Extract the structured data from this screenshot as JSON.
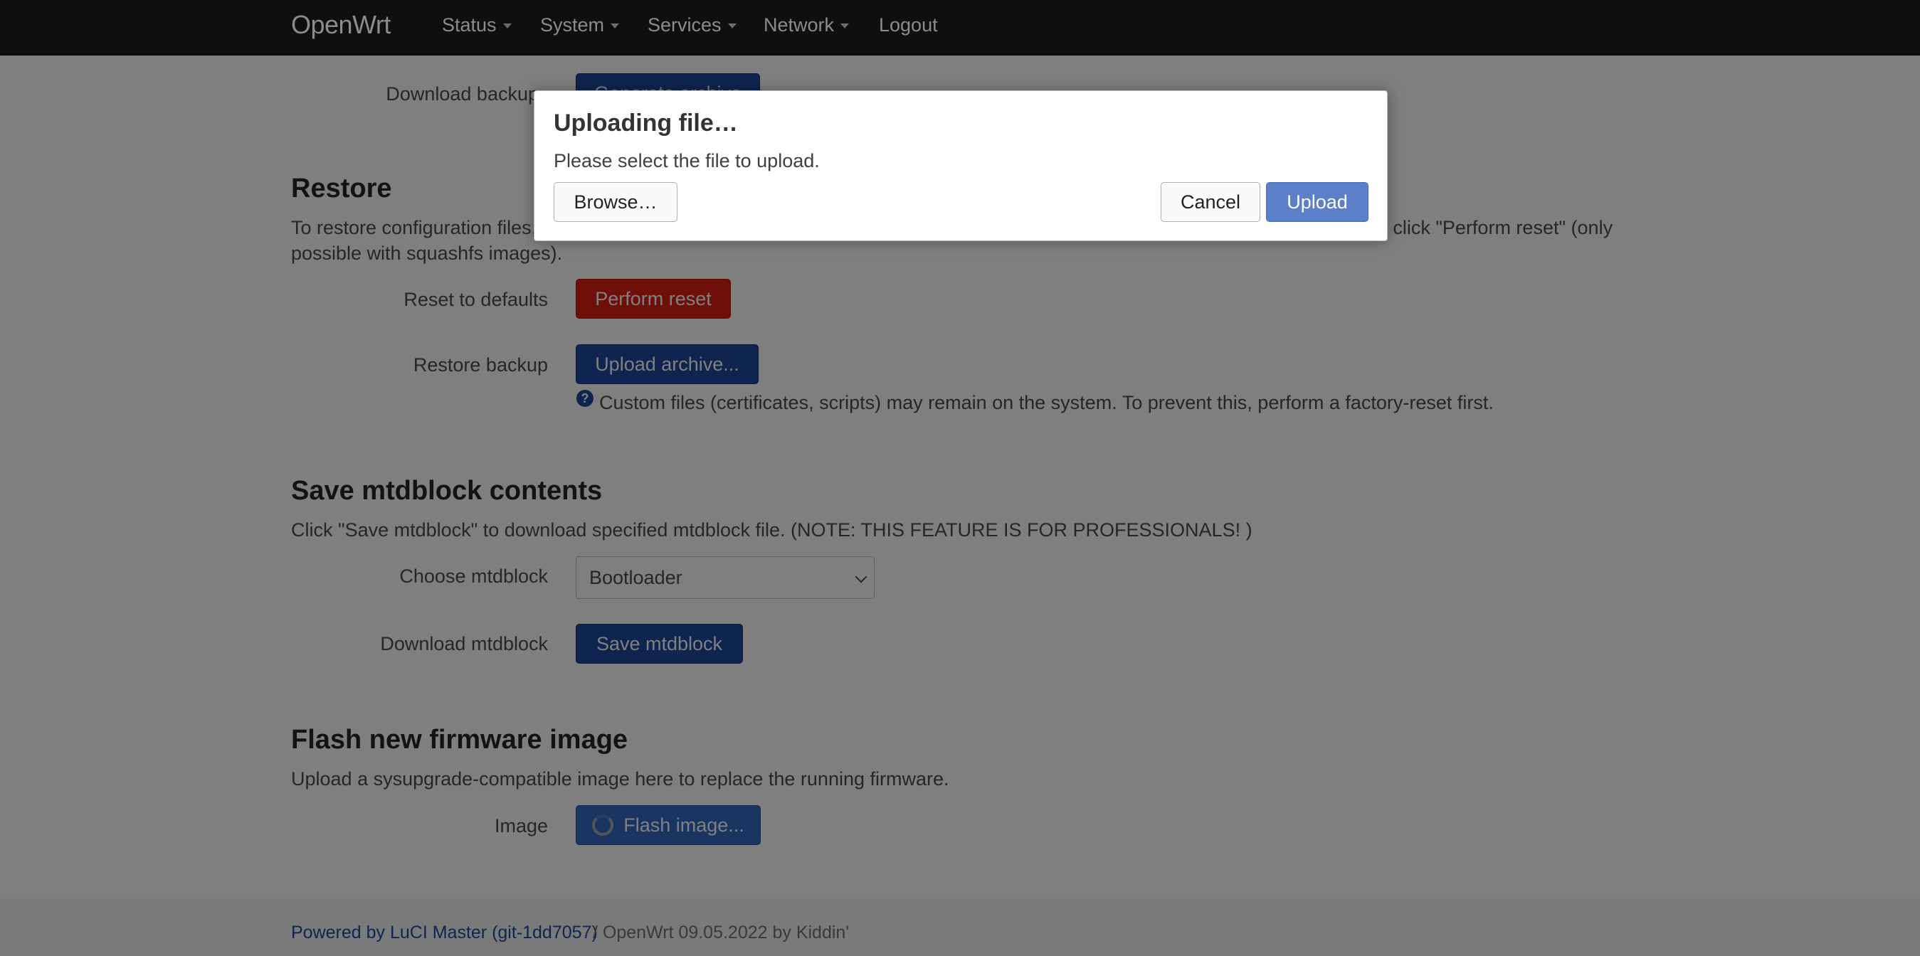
{
  "navbar": {
    "brand": "OpenWrt",
    "items": [
      "Status",
      "System",
      "Services",
      "Network"
    ],
    "logout": "Logout"
  },
  "backup": {
    "download_label": "Download backup",
    "generate_label": "Generate archive"
  },
  "restore": {
    "title": "Restore",
    "description_line1": "To restore configuration files, you can upload a previously generated backup archive here. To reset the firmware to its initial state, click \"Perform reset\" (only",
    "description_line2": "possible with squashfs images).",
    "reset_label": "Reset to defaults",
    "reset_button": "Perform reset",
    "restore_label": "Restore backup",
    "upload_button": "Upload archive...",
    "help_text": "Custom files (certificates, scripts) may remain on the system. To prevent this, perform a factory-reset first."
  },
  "mtd": {
    "title": "Save mtdblock contents",
    "description": "Click \"Save mtdblock\" to download specified mtdblock file. (NOTE: THIS FEATURE IS FOR PROFESSIONALS! )",
    "choose_label": "Choose mtdblock",
    "selected": "Bootloader",
    "download_label": "Download mtdblock",
    "save_button": "Save mtdblock"
  },
  "flash": {
    "title": "Flash new firmware image",
    "description": "Upload a sysupgrade-compatible image here to replace the running firmware.",
    "image_label": "Image",
    "flash_button": "Flash image..."
  },
  "footer": {
    "powered_by": "Powered by LuCI Master (git-1dd7057)",
    "version": "/ OpenWrt 09.05.2022 by Kiddin'"
  },
  "modal": {
    "title": "Uploading file…",
    "text": "Please select the file to upload.",
    "browse": "Browse…",
    "cancel": "Cancel",
    "upload": "Upload"
  },
  "colors": {
    "overlay": "#7f7f7f",
    "primary": "#5b7fc8",
    "danger": "#6e0f0a"
  }
}
